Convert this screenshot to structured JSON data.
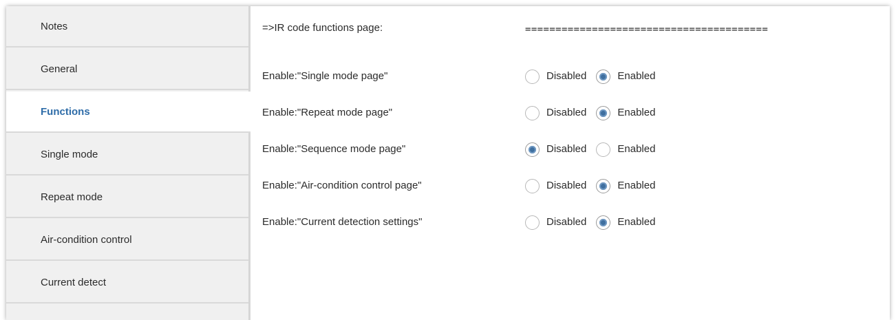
{
  "sidebar": {
    "items": [
      {
        "label": "Notes",
        "active": false
      },
      {
        "label": "General",
        "active": false
      },
      {
        "label": "Functions",
        "active": true
      },
      {
        "label": "Single mode",
        "active": false
      },
      {
        "label": "Repeat mode",
        "active": false
      },
      {
        "label": "Air-condition control",
        "active": false
      },
      {
        "label": "Current detect",
        "active": false
      }
    ]
  },
  "content": {
    "header": {
      "label": "=>IR code functions page:",
      "value": "========================================"
    },
    "options": {
      "disabled_label": "Disabled",
      "enabled_label": "Enabled"
    },
    "rows": [
      {
        "label": "Enable:\"Single mode page\"",
        "selected": "Enabled"
      },
      {
        "label": "Enable:\"Repeat mode page\"",
        "selected": "Enabled"
      },
      {
        "label": "Enable:\"Sequence mode page\"",
        "selected": "Disabled"
      },
      {
        "label": "Enable:\"Air-condition control page\"",
        "selected": "Enabled"
      },
      {
        "label": "Enable:\"Current detection settings\"",
        "selected": "Enabled"
      }
    ]
  },
  "colors": {
    "active_nav_text": "#2e6ca8",
    "radio_checked": "#3f6f9f",
    "sidebar_bg": "#f0f0f0"
  }
}
